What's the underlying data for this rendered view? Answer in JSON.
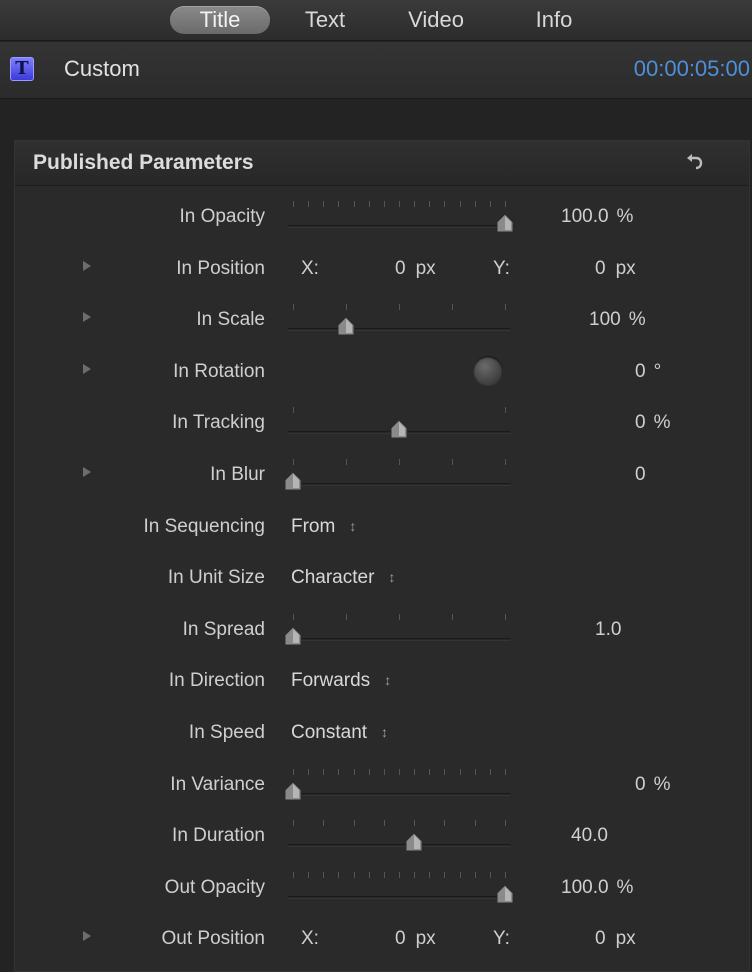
{
  "tabs": [
    {
      "label": "Title",
      "active": true
    },
    {
      "label": "Text",
      "active": false
    },
    {
      "label": "Video",
      "active": false
    },
    {
      "label": "Info",
      "active": false
    }
  ],
  "header": {
    "icon": "title-T-icon",
    "title": "Custom",
    "timecode": "00:00:05:00"
  },
  "panel": {
    "title": "Published Parameters",
    "reset_icon": "reset-arrow-icon"
  },
  "parameters": [
    {
      "label": "In Opacity",
      "type": "slider",
      "value": 100.0,
      "value_text": "100.0",
      "unit": "%",
      "has_disclosure": false
    },
    {
      "label": "In Position",
      "type": "xy",
      "x_label": "X:",
      "x_value": "0",
      "x_unit": "px",
      "y_label": "Y:",
      "y_value": "0",
      "y_unit": "px",
      "has_disclosure": true
    },
    {
      "label": "In Scale",
      "type": "slider",
      "value": 100,
      "value_text": "100",
      "unit": "%",
      "has_disclosure": true
    },
    {
      "label": "In Rotation",
      "type": "dial",
      "value_text": "0",
      "unit": "°",
      "has_disclosure": true
    },
    {
      "label": "In Tracking",
      "type": "slider",
      "value": 0,
      "value_text": "0",
      "unit": "%",
      "has_disclosure": false
    },
    {
      "label": "In Blur",
      "type": "slider",
      "value": 0,
      "value_text": "0",
      "unit": "",
      "has_disclosure": true
    },
    {
      "label": "In Sequencing",
      "type": "popup",
      "value_text": "From",
      "has_disclosure": false
    },
    {
      "label": "In Unit Size",
      "type": "popup",
      "value_text": "Character",
      "has_disclosure": false
    },
    {
      "label": "In Spread",
      "type": "slider",
      "value": 1.0,
      "value_text": "1.0",
      "unit": "",
      "has_disclosure": false
    },
    {
      "label": "In Direction",
      "type": "popup",
      "value_text": "Forwards",
      "has_disclosure": false
    },
    {
      "label": "In Speed",
      "type": "popup",
      "value_text": "Constant",
      "has_disclosure": false
    },
    {
      "label": "In Variance",
      "type": "slider",
      "value": 0,
      "value_text": "0",
      "unit": "%",
      "has_disclosure": false
    },
    {
      "label": "In Duration",
      "type": "slider",
      "value": 40.0,
      "value_text": "40.0",
      "unit": "",
      "has_disclosure": false
    },
    {
      "label": "Out Opacity",
      "type": "slider",
      "value": 100.0,
      "value_text": "100.0",
      "unit": "%",
      "has_disclosure": false
    },
    {
      "label": "Out Position",
      "type": "xy",
      "x_label": "X:",
      "x_value": "0",
      "x_unit": "px",
      "y_label": "Y:",
      "y_value": "0",
      "y_unit": "px",
      "has_disclosure": true
    }
  ],
  "colors": {
    "accent_timecode": "#4f8fd8",
    "title_icon": "#5a5aff"
  }
}
